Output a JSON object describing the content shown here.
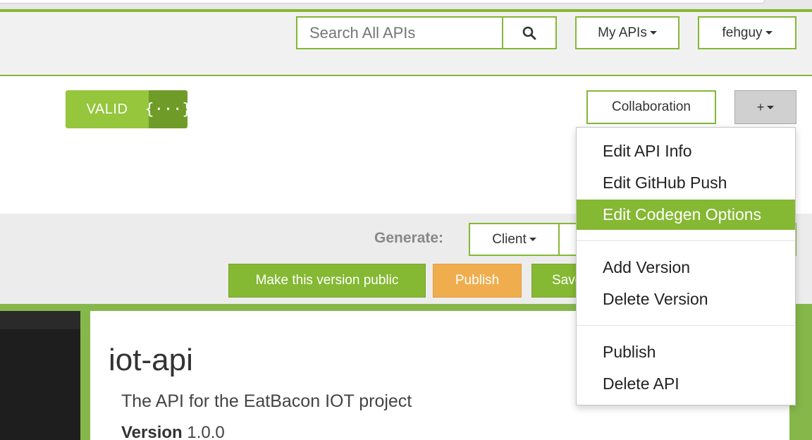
{
  "navbar": {
    "search_placeholder": "Search All APIs",
    "search_icon": "search-icon",
    "my_apis_label": "My APIs",
    "user_label": "fehguy"
  },
  "editor": {
    "valid_label": "VALID",
    "valid_icon_glyph": "{···}",
    "collaboration_label": "Collaboration",
    "plus_label": "+"
  },
  "toolbar": {
    "generate_label": "Generate:",
    "client_label": "Client",
    "make_public_label": "Make this version public",
    "publish_label": "Publish",
    "save_label": "Save"
  },
  "dropdown": {
    "items": [
      {
        "label": "Edit API Info"
      },
      {
        "label": "Edit GitHub Push"
      },
      {
        "label": "Edit Codegen Options",
        "active": true
      },
      {
        "label": "Add Version"
      },
      {
        "label": "Delete Version"
      },
      {
        "label": "Publish"
      },
      {
        "label": "Delete API"
      }
    ]
  },
  "api_info": {
    "title": "iot-api",
    "description": "The API for the EatBacon IOT project",
    "version_label": "Version",
    "version_value": "1.0.0"
  },
  "colors": {
    "accent_green": "#85b833",
    "valid_green": "#95c63b",
    "valid_dark_green": "#6f9b28",
    "publish_orange": "#f0ad4e",
    "lower_green": "#86b74a"
  }
}
